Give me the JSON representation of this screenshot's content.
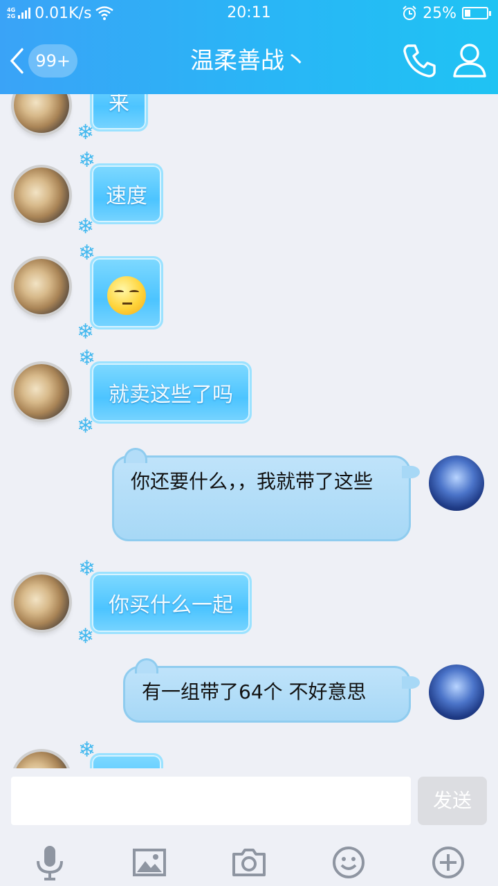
{
  "status_bar": {
    "network": "4G\n2G",
    "speed": "0.01K/s",
    "time": "20:11",
    "battery_pct": "25%",
    "battery_level": 0.25
  },
  "nav": {
    "unread_badge": "99+",
    "title": "温柔善战丶"
  },
  "messages": [
    {
      "sender": "friend",
      "type": "text",
      "text": "来"
    },
    {
      "sender": "friend",
      "type": "text",
      "text": "速度"
    },
    {
      "sender": "friend",
      "type": "emoji",
      "emoji": "side-eye-face-emoji"
    },
    {
      "sender": "friend",
      "type": "text",
      "text": "就卖这些了吗"
    },
    {
      "sender": "me",
      "type": "text",
      "text": "你还要什么，，我就带了这些"
    },
    {
      "sender": "friend",
      "type": "text",
      "text": "你买什么一起"
    },
    {
      "sender": "me",
      "type": "text",
      "text": "有一组带了64个 不好意思"
    },
    {
      "sender": "friend",
      "type": "text",
      "text": ""
    }
  ],
  "input": {
    "value": "",
    "send_label": "发送"
  },
  "toolbar": {
    "icons": [
      "microphone-icon",
      "image-icon",
      "camera-icon",
      "emoji-icon",
      "plus-icon"
    ]
  },
  "colors": {
    "header_start": "#3aa3f7",
    "header_end": "#1fc3f3",
    "friend_bubble": "#4cc4ff",
    "my_bubble": "#a7d8f6",
    "background": "#eef0f6"
  }
}
